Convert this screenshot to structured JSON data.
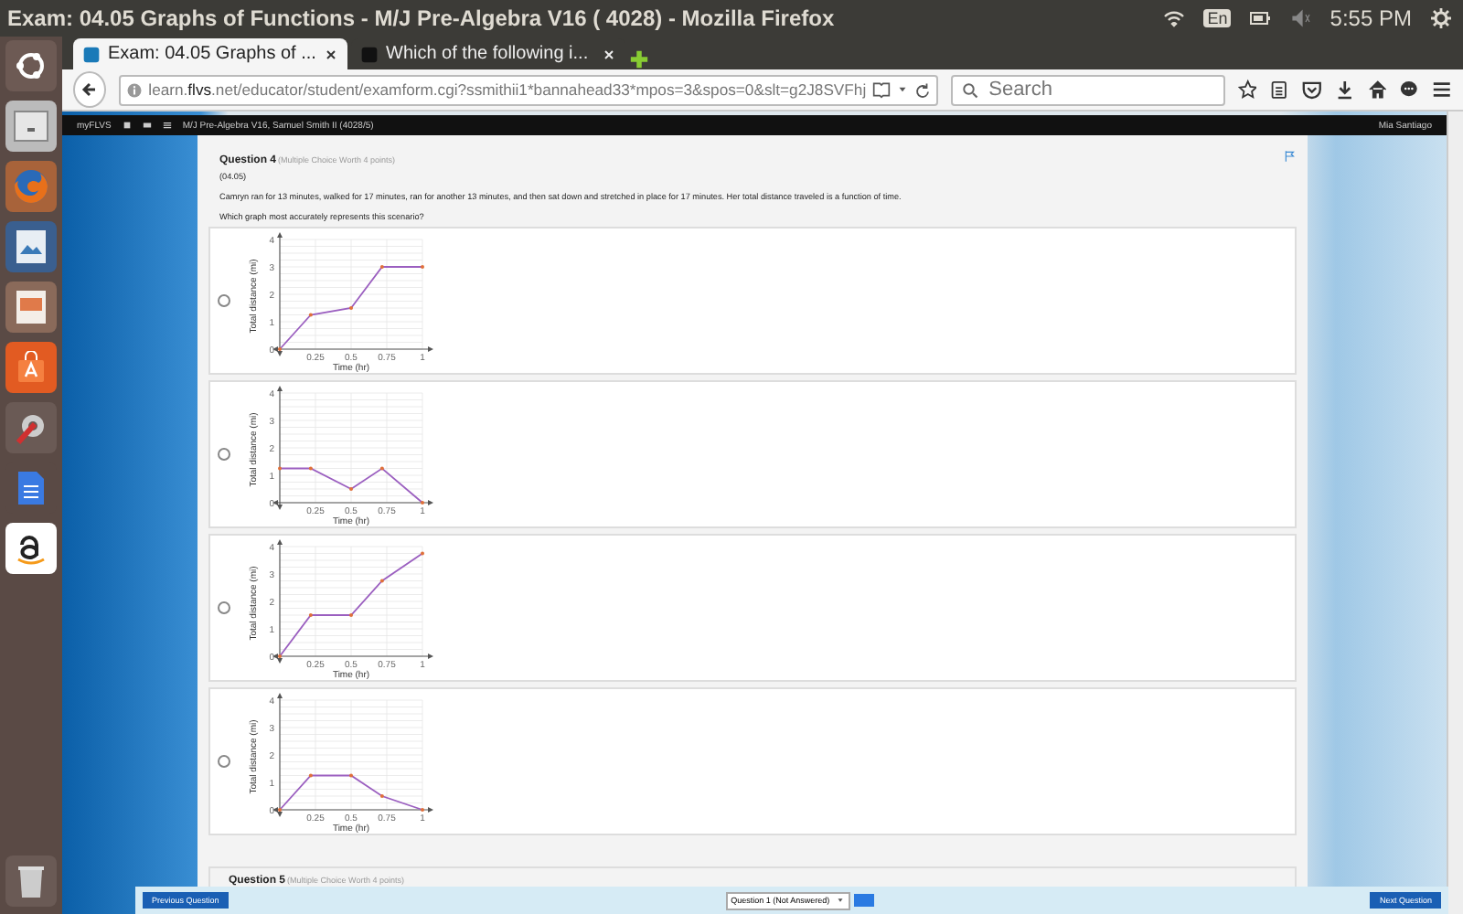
{
  "top_panel": {
    "title": "Exam: 04.05 Graphs of Functions - M/J Pre-Algebra V16 ( 4028) - Mozilla Firefox",
    "keyboard": "En",
    "clock": "5:55 PM"
  },
  "tabs": [
    {
      "label": "Exam: 04.05 Graphs of ...",
      "selected": true
    },
    {
      "label": "Which of the following i...",
      "selected": false
    }
  ],
  "address_bar": {
    "url": "learn.**flvs**.net/educator/student/examform.cgi?ssmithii1*bannahead33*mpos=3&spos=0&slt=g2J8SVFhj",
    "search_placeholder": "Search"
  },
  "site_bar": {
    "brand": "myFLVS",
    "course": "M/J Pre-Algebra V16, Samuel Smith II (4028/5)",
    "user": "Mia Santiago"
  },
  "question": {
    "title": "Question 4",
    "worth": "(Multiple Choice Worth 4 points)",
    "code": "(04.05)",
    "text": "Camryn ran for 13 minutes, walked for 17 minutes, ran for another 13 minutes, and then sat down and stretched in place for 17 minutes. Her total distance traveled is a function of time.",
    "prompt": "Which graph most accurately represents this scenario?",
    "options": [
      {
        "selected": false,
        "chart_data": {
          "type": "line",
          "grid": true,
          "xlabel": "Time (hr)",
          "ylabel": "Total distance (mi)",
          "x": [
            0,
            0.217,
            0.5,
            0.717,
            1
          ],
          "values": [
            0,
            1.25,
            1.5,
            3,
            3
          ],
          "xlim": [
            0,
            1
          ],
          "ylim": [
            0,
            4
          ],
          "xticks": [
            0.25,
            0.5,
            0.75,
            1
          ],
          "yticks": [
            0,
            1,
            2,
            3,
            4
          ]
        }
      },
      {
        "selected": false,
        "chart_data": {
          "type": "line",
          "grid": true,
          "xlabel": "Time (hr)",
          "ylabel": "Total distance (mi)",
          "x": [
            0,
            0.217,
            0.5,
            0.717,
            1
          ],
          "values": [
            1.25,
            1.25,
            0.5,
            1.25,
            0
          ],
          "xlim": [
            0,
            1
          ],
          "ylim": [
            0,
            4
          ],
          "xticks": [
            0.25,
            0.5,
            0.75,
            1
          ],
          "yticks": [
            0,
            1,
            2,
            3,
            4
          ]
        }
      },
      {
        "selected": false,
        "chart_data": {
          "type": "line",
          "grid": true,
          "xlabel": "Time (hr)",
          "ylabel": "Total distance (mi)",
          "x": [
            0,
            0.217,
            0.5,
            0.717,
            1
          ],
          "values": [
            0,
            1.5,
            1.5,
            2.75,
            3.75
          ],
          "xlim": [
            0,
            1
          ],
          "ylim": [
            0,
            4
          ],
          "xticks": [
            0.25,
            0.5,
            0.75,
            1
          ],
          "yticks": [
            0,
            1,
            2,
            3,
            4
          ]
        }
      },
      {
        "selected": false,
        "chart_data": {
          "type": "line",
          "grid": true,
          "xlabel": "Time (hr)",
          "ylabel": "Total distance (mi)",
          "x": [
            0,
            0.217,
            0.5,
            0.717,
            1
          ],
          "values": [
            0,
            1.25,
            1.25,
            0.5,
            0
          ],
          "xlim": [
            0,
            1
          ],
          "ylim": [
            0,
            4
          ],
          "xticks": [
            0.25,
            0.5,
            0.75,
            1
          ],
          "yticks": [
            0,
            1,
            2,
            3,
            4
          ]
        }
      }
    ]
  },
  "next_question": {
    "title": "Question 5",
    "worth": "(Multiple Choice Worth 4 points)"
  },
  "footer": {
    "previous": "Previous Question",
    "selector": "Question 1 (Not Answered)",
    "next": "Next Question"
  }
}
